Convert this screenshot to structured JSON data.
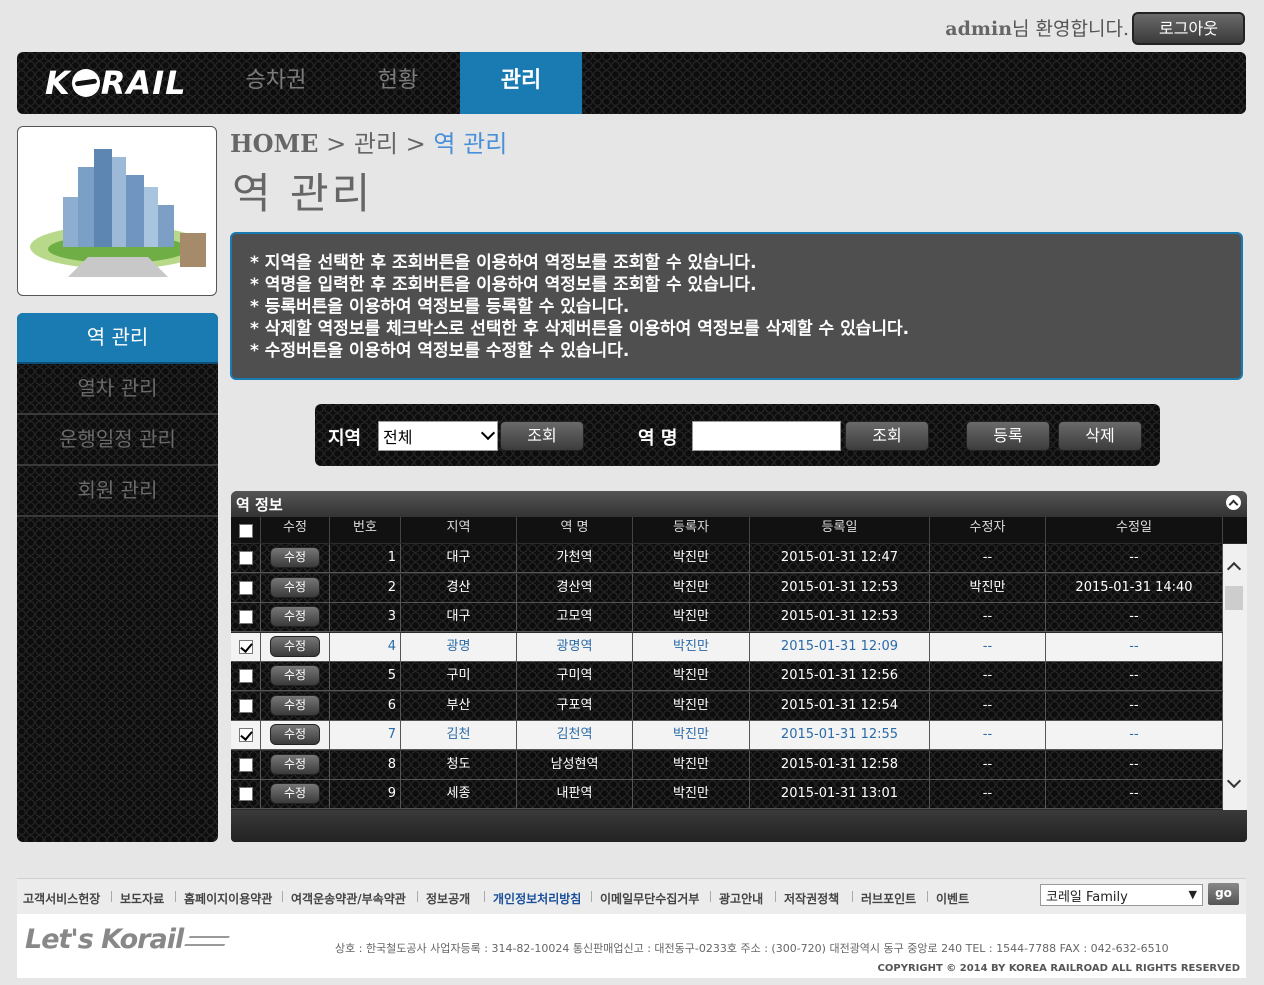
{
  "header": {
    "welcome_user": "admin",
    "welcome_text": "님 환영합니다.",
    "logout_label": "로그아웃",
    "logo_text": "KORAIL",
    "nav": [
      {
        "label": "승차권",
        "active": false
      },
      {
        "label": "현황",
        "active": false
      },
      {
        "label": "관리",
        "active": true
      }
    ]
  },
  "sidebar": {
    "items": [
      {
        "label": "역 관리",
        "active": true
      },
      {
        "label": "열차 관리",
        "active": false
      },
      {
        "label": "운행일정 관리",
        "active": false
      },
      {
        "label": "회원 관리",
        "active": false
      }
    ]
  },
  "breadcrumb": {
    "home": "HOME",
    "sep": ">",
    "section": "관리",
    "current": "역 관리"
  },
  "page_title": "역 관리",
  "info_lines": [
    "* 지역을 선택한 후 조회버튼을 이용하여 역정보를 조회할 수 있습니다.",
    "* 역명을 입력한 후 조회버튼을 이용하여 역정보를 조회할 수 있습니다.",
    "* 등록버튼을 이용하여 역정보를 등록할 수 있습니다.",
    "* 삭제할 역정보를 체크박스로 선택한 후 삭제버튼을 이용하여 역정보를 삭제할 수 있습니다.",
    "* 수정버튼을 이용하여 역정보를 수정할 수 있습니다."
  ],
  "search": {
    "region_label": "지역",
    "region_value": "전체",
    "search_label": "조회",
    "station_label": "역 명",
    "station_value": "",
    "register_label": "등록",
    "delete_label": "삭제"
  },
  "table": {
    "title": "역 정보",
    "columns": [
      "수정",
      "번호",
      "지역",
      "역 명",
      "등록자",
      "등록일",
      "수정자",
      "수정일"
    ],
    "edit_label": "수정",
    "rows": [
      {
        "checked": false,
        "no": "1",
        "region": "대구",
        "station": "가천역",
        "registrant": "박진만",
        "reg_date": "2015-01-31 12:47",
        "modifier": "--",
        "mod_date": "--"
      },
      {
        "checked": false,
        "no": "2",
        "region": "경산",
        "station": "경산역",
        "registrant": "박진만",
        "reg_date": "2015-01-31 12:53",
        "modifier": "박진만",
        "mod_date": "2015-01-31 14:40"
      },
      {
        "checked": false,
        "no": "3",
        "region": "대구",
        "station": "고모역",
        "registrant": "박진만",
        "reg_date": "2015-01-31 12:53",
        "modifier": "--",
        "mod_date": "--"
      },
      {
        "checked": true,
        "no": "4",
        "region": "광명",
        "station": "광명역",
        "registrant": "박진만",
        "reg_date": "2015-01-31 12:09",
        "modifier": "--",
        "mod_date": "--"
      },
      {
        "checked": false,
        "no": "5",
        "region": "구미",
        "station": "구미역",
        "registrant": "박진만",
        "reg_date": "2015-01-31 12:56",
        "modifier": "--",
        "mod_date": "--"
      },
      {
        "checked": false,
        "no": "6",
        "region": "부산",
        "station": "구포역",
        "registrant": "박진만",
        "reg_date": "2015-01-31 12:54",
        "modifier": "--",
        "mod_date": "--"
      },
      {
        "checked": true,
        "no": "7",
        "region": "김천",
        "station": "김천역",
        "registrant": "박진만",
        "reg_date": "2015-01-31 12:55",
        "modifier": "--",
        "mod_date": "--"
      },
      {
        "checked": false,
        "no": "8",
        "region": "청도",
        "station": "남성현역",
        "registrant": "박진만",
        "reg_date": "2015-01-31 12:58",
        "modifier": "--",
        "mod_date": "--"
      },
      {
        "checked": false,
        "no": "9",
        "region": "세종",
        "station": "내판역",
        "registrant": "박진만",
        "reg_date": "2015-01-31 13:01",
        "modifier": "--",
        "mod_date": "--"
      }
    ]
  },
  "footer": {
    "links": [
      {
        "label": "고객서비스헌장",
        "highlight": false
      },
      {
        "label": "보도자료",
        "highlight": false
      },
      {
        "label": "홈페이지이용약관",
        "highlight": false
      },
      {
        "label": "여객운송약관/부속약관",
        "highlight": false
      },
      {
        "label": "정보공개",
        "highlight": false
      },
      {
        "label": "개인정보처리방침",
        "highlight": true
      },
      {
        "label": "이메일무단수집거부",
        "highlight": false
      },
      {
        "label": "광고안내",
        "highlight": false
      },
      {
        "label": "저작권정책",
        "highlight": false
      },
      {
        "label": "러브포인트",
        "highlight": false
      },
      {
        "label": "이벤트",
        "highlight": false
      }
    ],
    "family_value": "코레일 Family",
    "go_label": "go",
    "brand": "Let's Korail",
    "company_info": "상호 : 한국철도공사   사업자등록 : 314-82-10024   통신판매업신고 : 대전동구-0233호   주소 : (300-720) 대전광역시 동구 중앙로 240   TEL : 1544-7788   FAX : 042-632-6510",
    "copyright": "COPYRIGHT © 2014 BY KOREA RAILROAD  ALL RIGHTS RESERVED"
  },
  "colors": {
    "accent": "#1a7ab2",
    "dark": "#0d0d0d",
    "info_bg": "#4f4f4f"
  }
}
